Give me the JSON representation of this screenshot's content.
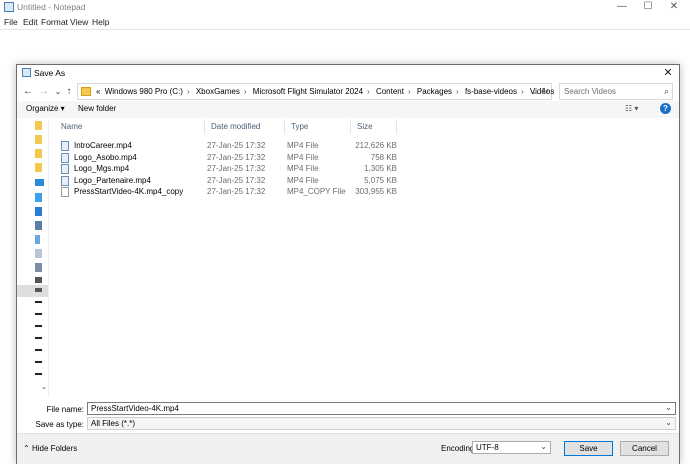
{
  "notepad": {
    "title": "Untitled - Notepad",
    "menu": [
      "File",
      "Edit",
      "Format",
      "View",
      "Help"
    ],
    "controls": {
      "minimize": "—",
      "maximize": "☐",
      "close": "✕"
    }
  },
  "dialog": {
    "title": "Save As",
    "close_glyph": "✕",
    "nav": {
      "back": "←",
      "forward": "→",
      "down": "⌄",
      "up": "↑"
    },
    "address": {
      "prefix": "«",
      "crumbs": [
        "Windows 980 Pro (C:)",
        "XboxGames",
        "Microsoft Flight Simulator 2024",
        "Content",
        "Packages",
        "fs-base-videos",
        "Videos"
      ],
      "separator": "›",
      "dropdown": "⌄",
      "refresh": "↻"
    },
    "search": {
      "placeholder": "Search Videos",
      "icon": "⌕"
    },
    "toolbar": {
      "organize": "Organize ▾",
      "new_folder": "New folder",
      "view": "☷ ▾",
      "help": "?"
    },
    "columns": [
      "Name",
      "Date modified",
      "Type",
      "Size"
    ],
    "files": [
      {
        "name": "IntroCareer.mp4",
        "date": "27-Jan-25 17:32",
        "type": "MP4 File",
        "size": "212,626 KB",
        "icon": "video-file-icon"
      },
      {
        "name": "Logo_Asobo.mp4",
        "date": "27-Jan-25 17:32",
        "type": "MP4 File",
        "size": "758 KB",
        "icon": "video-file-icon"
      },
      {
        "name": "Logo_Mgs.mp4",
        "date": "27-Jan-25 17:32",
        "type": "MP4 File",
        "size": "1,305 KB",
        "icon": "video-file-icon"
      },
      {
        "name": "Logo_Partenaire.mp4",
        "date": "27-Jan-25 17:32",
        "type": "MP4 File",
        "size": "5,075 KB",
        "icon": "video-file-icon"
      },
      {
        "name": "PressStartVideo-4K.mp4_copy",
        "date": "27-Jan-25 17:32",
        "type": "MP4_COPY File",
        "size": "303,955 KB",
        "icon": "generic-file-icon"
      }
    ],
    "file_name_label": "File name:",
    "file_name_value": "PressStartVideo-4K.mp4",
    "save_type_label": "Save as type:",
    "save_type_value": "All Files  (*.*)",
    "hide_folders": "Hide Folders",
    "encoding_label": "Encoding:",
    "encoding_value": "UTF-8",
    "save_button": "Save",
    "cancel_button": "Cancel",
    "colors": {
      "accent": "#0078d7",
      "folder": "#f2c94c",
      "help": "#1a6fc4"
    }
  }
}
